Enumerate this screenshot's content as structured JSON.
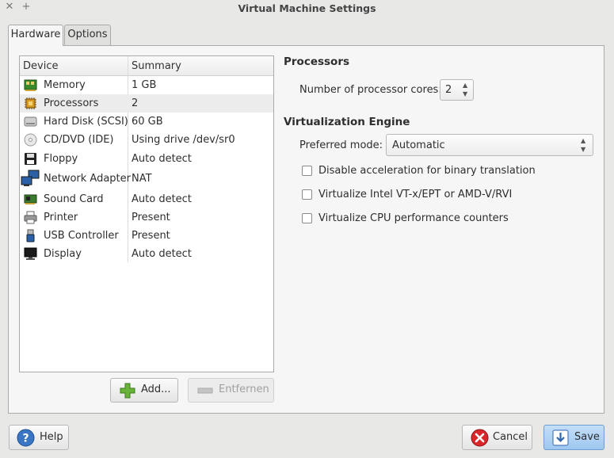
{
  "window": {
    "title": "Virtual Machine Settings"
  },
  "tabs": [
    {
      "label": "Hardware",
      "active": true
    },
    {
      "label": "Options",
      "active": false
    }
  ],
  "device_list": {
    "columns": [
      "Device",
      "Summary"
    ],
    "rows": [
      {
        "name": "Memory",
        "summary": "1 GB",
        "icon": "memory-icon"
      },
      {
        "name": "Processors",
        "summary": "2",
        "icon": "processor-icon",
        "selected": true
      },
      {
        "name": "Hard Disk (SCSI)",
        "summary": "60 GB",
        "icon": "hard-disk-icon"
      },
      {
        "name": "CD/DVD (IDE)",
        "summary": "Using drive /dev/sr0",
        "icon": "cd-dvd-icon"
      },
      {
        "name": "Floppy",
        "summary": "Auto detect",
        "icon": "floppy-icon"
      },
      {
        "name": "Network Adapter",
        "summary": "NAT",
        "icon": "network-icon"
      },
      {
        "name": "Sound Card",
        "summary": "Auto detect",
        "icon": "sound-card-icon"
      },
      {
        "name": "Printer",
        "summary": "Present",
        "icon": "printer-icon"
      },
      {
        "name": "USB Controller",
        "summary": "Present",
        "icon": "usb-icon"
      },
      {
        "name": "Display",
        "summary": "Auto detect",
        "icon": "display-icon"
      }
    ]
  },
  "buttons": {
    "add": "Add...",
    "remove": "Entfernen",
    "help": "Help",
    "cancel": "Cancel",
    "save": "Save"
  },
  "processors": {
    "heading": "Processors",
    "cores_label": "Number of processor cores:",
    "cores_value": "2"
  },
  "virtualization": {
    "heading": "Virtualization Engine",
    "mode_label": "Preferred mode:",
    "mode_value": "Automatic",
    "options": [
      {
        "label": "Disable acceleration for binary translation",
        "checked": false
      },
      {
        "label": "Virtualize Intel VT-x/EPT or AMD-V/RVI",
        "checked": false
      },
      {
        "label": "Virtualize CPU performance counters",
        "checked": false
      }
    ]
  },
  "colors": {
    "save_accent": "#a9d0f5",
    "help_icon": "#3a76c4",
    "cancel_icon": "#d9262b",
    "add_icon": "#6ab33b"
  }
}
